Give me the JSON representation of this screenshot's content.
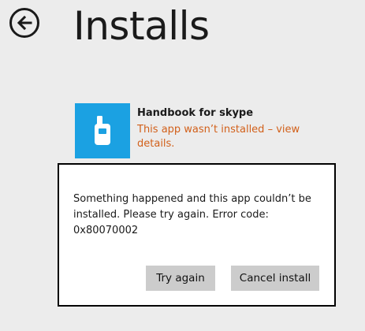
{
  "header": {
    "title": "Installs",
    "back_icon": "back-arrow-icon"
  },
  "app": {
    "name": "Handbook for skype",
    "status": "This app wasn’t installed – view details.",
    "tile_color": "#1ba1e2",
    "icon": "phone-icon",
    "status_color": "#d2601a"
  },
  "dialog": {
    "message": "Something happened and this app couldn’t be installed. Please try again. Error code: 0x80070002",
    "try_again_label": "Try again",
    "cancel_label": "Cancel install"
  }
}
